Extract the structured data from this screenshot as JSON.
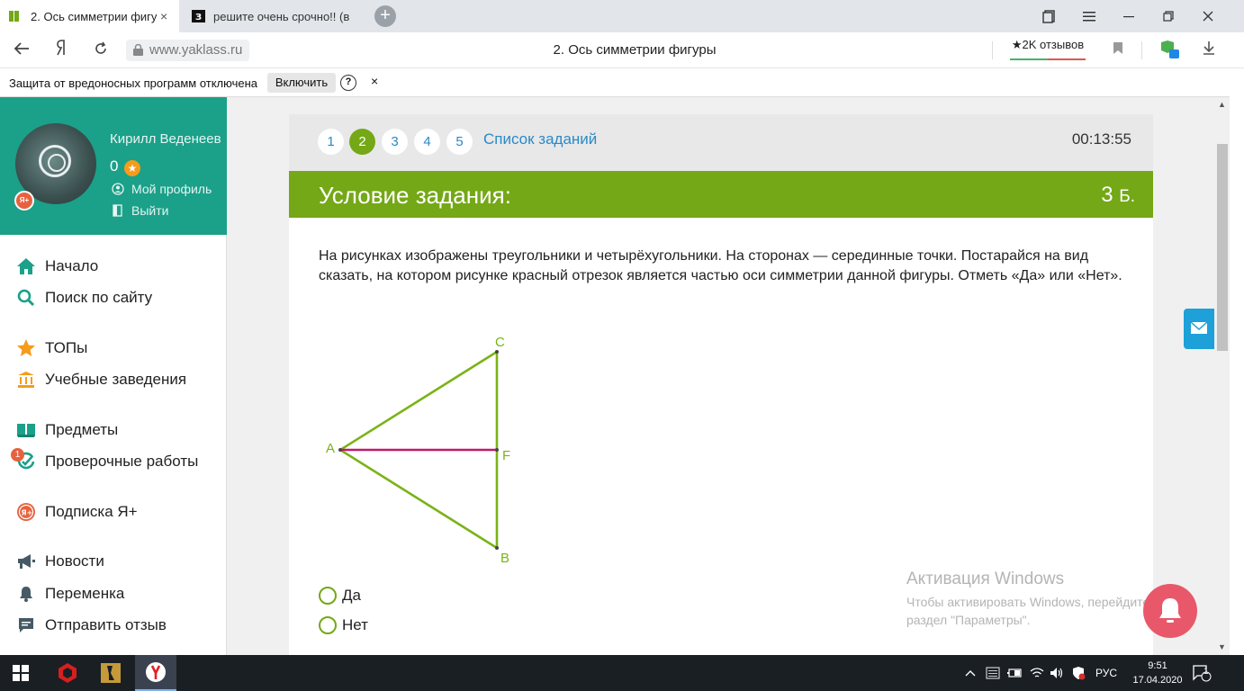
{
  "browser": {
    "tabs": [
      {
        "title": "2. Ось симметрии фигуры",
        "active": true
      },
      {
        "title": "решите очень срочно!! (в",
        "active": false
      }
    ],
    "tab_close": "×",
    "new_tab": "+",
    "url": "www.yaklass.ru",
    "page_title": "2. Ось симметрии фигуры",
    "reviews": "★2K отзывов",
    "protection_message": "Защита от вредоносных программ отключена",
    "protection_enable": "Включить",
    "protection_help": "?",
    "protection_close": "×"
  },
  "profile": {
    "name": "Кирилл Веденеев",
    "score": "0",
    "badge": "Я+",
    "my_profile": "Мой профиль",
    "logout": "Выйти"
  },
  "sidebar": {
    "items": [
      {
        "label": "Начало",
        "icon": "home-icon"
      },
      {
        "label": "Поиск по сайту",
        "icon": "search-icon"
      },
      {
        "label": "ТОПы",
        "icon": "star-icon"
      },
      {
        "label": "Учебные заведения",
        "icon": "institution-icon"
      },
      {
        "label": "Предметы",
        "icon": "book-icon"
      },
      {
        "label": "Проверочные работы",
        "icon": "check-icon"
      },
      {
        "label": "Подписка Я+",
        "icon": "yaplus-icon"
      },
      {
        "label": "Новости",
        "icon": "megaphone-icon"
      },
      {
        "label": "Переменка",
        "icon": "bell-icon"
      },
      {
        "label": "Отправить отзыв",
        "icon": "chat-icon"
      }
    ],
    "tests_badge": "1"
  },
  "task": {
    "numbers": [
      "1",
      "2",
      "3",
      "4",
      "5"
    ],
    "current": "2",
    "list_label": "Список заданий",
    "timer": "00:13:55",
    "condition_title": "Условие задания:",
    "points": "3",
    "points_unit": "Б.",
    "question": "На рисунках изображены треугольники и четырёхугольники. На сторонах — серединные точки. Постарайся на вид сказать, на котором рисунке красный отрезок является частью оси симметрии данной фигуры. Отметь «Да» или «Нет».",
    "figure_labels": {
      "a": "A",
      "b": "B",
      "c": "C",
      "f": "F"
    },
    "options": [
      "Да",
      "Нет"
    ]
  },
  "watermark": {
    "title": "Активация Windows",
    "text": "Чтобы активировать Windows, перейдите в раздел \"Параметры\"."
  },
  "taskbar": {
    "lang": "РУС",
    "time": "9:51",
    "date": "17.04.2020",
    "notifications": "1"
  },
  "colors": {
    "accent_green": "#74a816",
    "profile_teal": "#1ba089",
    "link_blue": "#2a89c9",
    "segment_magenta": "#c0186c"
  }
}
